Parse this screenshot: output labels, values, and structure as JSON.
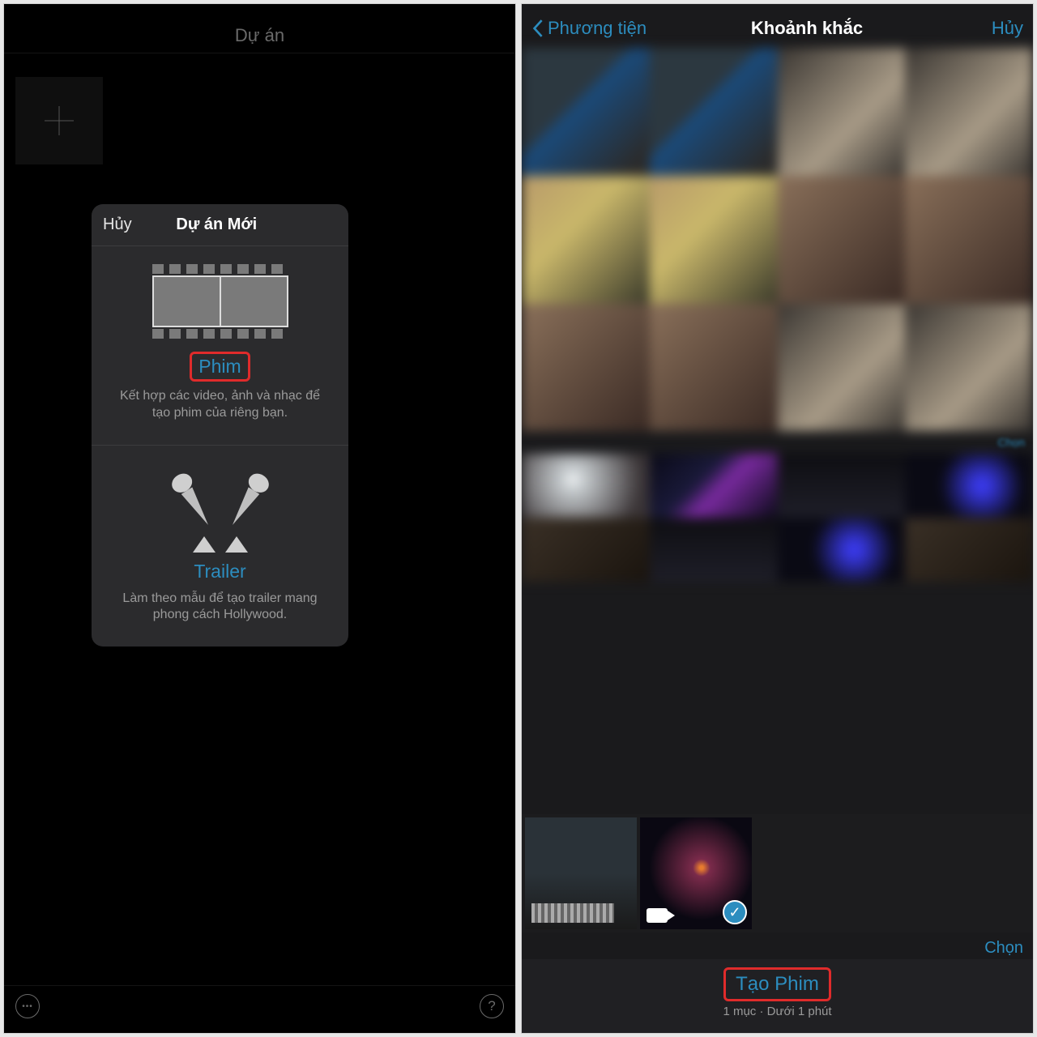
{
  "left": {
    "title": "Dự án",
    "sheet": {
      "cancel": "Hủy",
      "title": "Dự án Mới",
      "movie": {
        "label": "Phim",
        "desc": "Kết hợp các video, ảnh và nhạc để tạo phim của riêng bạn."
      },
      "trailer": {
        "label": "Trailer",
        "desc": "Làm theo mẫu để tạo trailer mang phong cách Hollywood."
      }
    }
  },
  "right": {
    "nav": {
      "back": "Phương tiện",
      "title": "Khoảnh khắc",
      "cancel": "Hủy"
    },
    "select": "Chọn",
    "create": {
      "label": "Tạo Phim",
      "sub": "1 mục · Dưới 1 phút"
    }
  }
}
